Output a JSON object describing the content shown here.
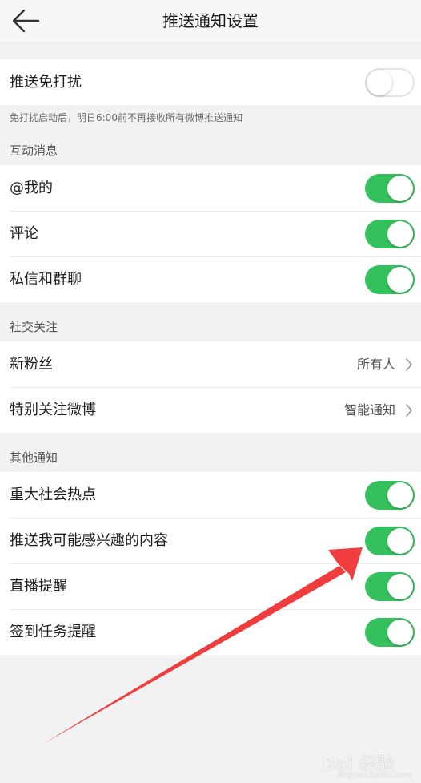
{
  "header": {
    "title": "推送通知设置",
    "back_icon": "arrow-left-icon"
  },
  "dnd": {
    "label": "推送免打扰",
    "enabled": false,
    "note": "免打扰启动后，明日6:00前不再接收所有微博推送通知"
  },
  "sections": {
    "interaction": {
      "title": "互动消息",
      "items": [
        {
          "label": "@我的",
          "enabled": true
        },
        {
          "label": "评论",
          "enabled": true
        },
        {
          "label": "私信和群聊",
          "enabled": true
        }
      ]
    },
    "social": {
      "title": "社交关注",
      "items": [
        {
          "label": "新粉丝",
          "value": "所有人"
        },
        {
          "label": "特别关注微博",
          "value": "智能通知"
        }
      ]
    },
    "other": {
      "title": "其他通知",
      "items": [
        {
          "label": "重大社会热点",
          "enabled": true
        },
        {
          "label": "推送我可能感兴趣的内容",
          "enabled": true
        },
        {
          "label": "直播提醒",
          "enabled": true
        },
        {
          "label": "签到任务提醒",
          "enabled": true
        }
      ]
    }
  },
  "watermark": {
    "logo": "Bai 经验",
    "sub": "jingyan.baidu.com"
  },
  "colors": {
    "toggle_on": "#34c05c",
    "background": "#f2f2f2",
    "annotation_arrow": "#f03c3c"
  }
}
